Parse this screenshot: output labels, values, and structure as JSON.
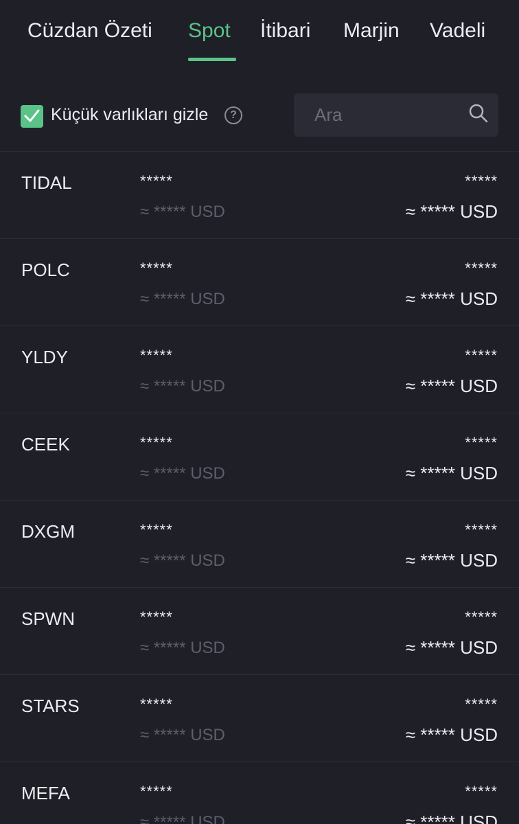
{
  "tabs": [
    {
      "label": "Cüzdan Özeti",
      "active": false
    },
    {
      "label": "Spot",
      "active": true
    },
    {
      "label": "İtibari",
      "active": false
    },
    {
      "label": "Marjin",
      "active": false
    },
    {
      "label": "Vadeli",
      "active": false
    }
  ],
  "accent_color": "#5ac387",
  "filter": {
    "hide_small_label": "Küçük varlıkları gizle",
    "hide_small_checked": true,
    "help_icon": "?",
    "search_placeholder": "Ara",
    "search_value": ""
  },
  "assets": [
    {
      "symbol": "TIDAL",
      "amount": "*****",
      "amount_usd": "≈ ***** USD",
      "value": "*****",
      "value_usd": "≈ ***** USD"
    },
    {
      "symbol": "POLC",
      "amount": "*****",
      "amount_usd": "≈ ***** USD",
      "value": "*****",
      "value_usd": "≈ ***** USD"
    },
    {
      "symbol": "YLDY",
      "amount": "*****",
      "amount_usd": "≈ ***** USD",
      "value": "*****",
      "value_usd": "≈ ***** USD"
    },
    {
      "symbol": "CEEK",
      "amount": "*****",
      "amount_usd": "≈ ***** USD",
      "value": "*****",
      "value_usd": "≈ ***** USD"
    },
    {
      "symbol": "DXGM",
      "amount": "*****",
      "amount_usd": "≈ ***** USD",
      "value": "*****",
      "value_usd": "≈ ***** USD"
    },
    {
      "symbol": "SPWN",
      "amount": "*****",
      "amount_usd": "≈ ***** USD",
      "value": "*****",
      "value_usd": "≈ ***** USD"
    },
    {
      "symbol": "STARS",
      "amount": "*****",
      "amount_usd": "≈ ***** USD",
      "value": "*****",
      "value_usd": "≈ ***** USD"
    },
    {
      "symbol": "MEFA",
      "amount": "*****",
      "amount_usd": "≈ ***** USD",
      "value": "*****",
      "value_usd": "≈ ***** USD"
    }
  ]
}
